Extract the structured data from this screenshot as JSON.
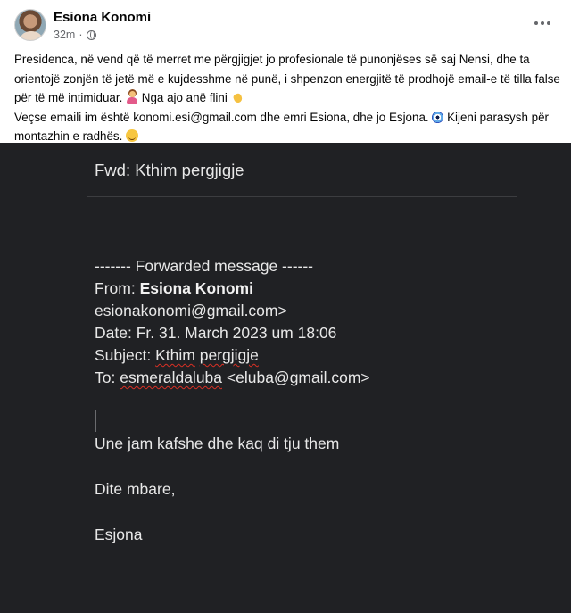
{
  "post": {
    "author": "Esiona Konomi",
    "timestamp": "32m",
    "separator": "·",
    "audience_icon": "globe-icon",
    "more_icon": "more-horizontal-icon",
    "text": {
      "line1": "Presidenca, në vend që të merret me përgjigjet jo profesionale të punonjëses së saj Nensi, dhe ta orientojë zonjën të jetë më e kujdesshme në punë, i shpenzon energjitë të prodhojë email-e të tilla false për të më intimiduar.",
      "line1_tail": "Nga ajo anë flini",
      "line2": "Veçse emaili im është konomi.esi@gmail.com dhe emri Esiona, dhe jo Esjona.",
      "line2_tail": "Kijeni parasysh për montazhin e radhës."
    }
  },
  "email": {
    "subject_line": "Fwd: Kthim pergjigje",
    "forwarded_header": "------- Forwarded message ------",
    "from_label": "From: ",
    "from_name": "Esiona Konomi",
    "from_email": "esionakonomi@gmail.com>",
    "date_label": "Date: ",
    "date_value": "Fr. 31. March 2023 um 18:06",
    "subject_label": "Subject: ",
    "subject_word1": "Kthim",
    "subject_word2": "pergjigje",
    "to_label": "To: ",
    "to_name": "esmeraldaluba",
    "to_email": "<eluba@gmail.com>",
    "message": "Une jam kafshe dhe kaq di tju them",
    "greeting": "Dite mbare,",
    "signature": "Esjona"
  },
  "colors": {
    "email_background": "#202124",
    "email_text": "#e8e8e8",
    "spellcheck_underline": "#d93025",
    "meta_gray": "#65676b"
  }
}
